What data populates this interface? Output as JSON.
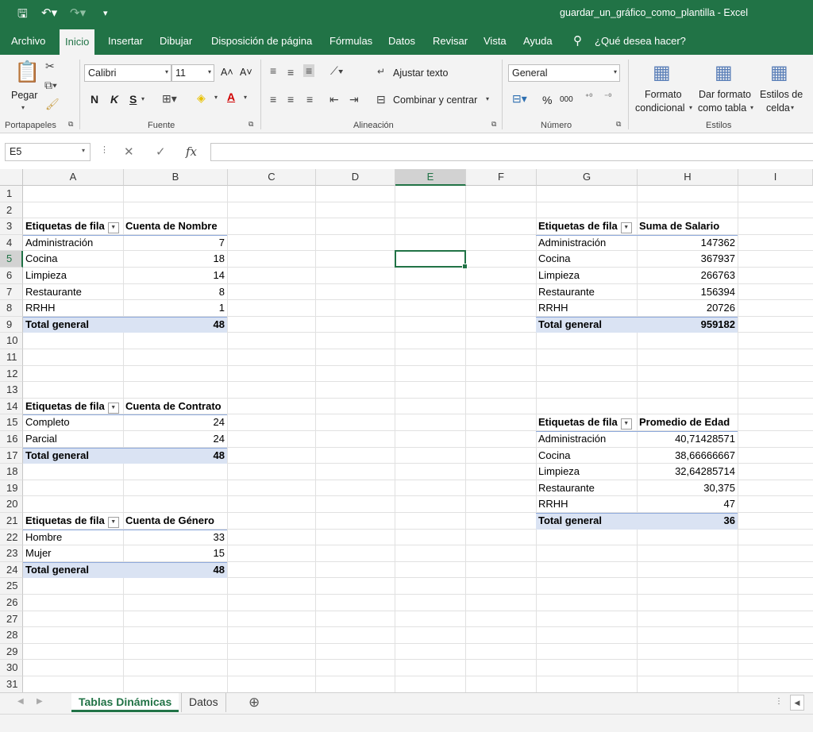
{
  "window": {
    "title": "guardar_un_gráfico_como_plantilla  -  Excel"
  },
  "tabs": [
    "Archivo",
    "Inicio",
    "Insertar",
    "Dibujar",
    "Disposición de página",
    "Fórmulas",
    "Datos",
    "Revisar",
    "Vista",
    "Ayuda"
  ],
  "tell_me": "¿Qué desea hacer?",
  "ribbon": {
    "pegar": "Pegar",
    "font_name": "Calibri",
    "font_size": "11",
    "bold": "N",
    "italic": "K",
    "underline": "S",
    "wrap_text": "Ajustar texto",
    "merge_center": "Combinar y centrar",
    "number_format": "General",
    "percent": "%",
    "thousands": "000",
    "cond_format_1": "Formato",
    "cond_format_2": "condicional",
    "format_table_1": "Dar formato",
    "format_table_2": "como tabla",
    "cell_styles_1": "Estilos de",
    "cell_styles_2": "celda",
    "groups": {
      "portapapeles": "Portapapeles",
      "fuente": "Fuente",
      "alineacion": "Alineación",
      "numero": "Número",
      "estilos": "Estilos"
    }
  },
  "formula_bar": {
    "name_box": "E5",
    "fx": "fx",
    "content": ""
  },
  "columns": [
    "A",
    "B",
    "C",
    "D",
    "E",
    "F",
    "G",
    "H",
    "I"
  ],
  "rows": [
    "1",
    "2",
    "3",
    "4",
    "5",
    "6",
    "7",
    "8",
    "9",
    "10",
    "11",
    "12",
    "13",
    "14",
    "15",
    "16",
    "17",
    "18",
    "19",
    "20",
    "21",
    "22",
    "23",
    "24",
    "25",
    "26",
    "27",
    "28",
    "29",
    "30",
    "31"
  ],
  "pivots": {
    "nombre": {
      "row_label": "Etiquetas de fila",
      "value_label": "Cuenta de Nombre",
      "rows": [
        {
          "label": "Administración",
          "value": "7"
        },
        {
          "label": "Cocina",
          "value": "18"
        },
        {
          "label": "Limpieza",
          "value": "14"
        },
        {
          "label": "Restaurante",
          "value": "8"
        },
        {
          "label": "RRHH",
          "value": "1"
        }
      ],
      "total_label": "Total general",
      "total": "48"
    },
    "contrato": {
      "row_label": "Etiquetas de fila",
      "value_label": "Cuenta de Contrato",
      "rows": [
        {
          "label": "Completo",
          "value": "24"
        },
        {
          "label": "Parcial",
          "value": "24"
        }
      ],
      "total_label": "Total general",
      "total": "48"
    },
    "genero": {
      "row_label": "Etiquetas de fila",
      "value_label": "Cuenta de Género",
      "rows": [
        {
          "label": "Hombre",
          "value": "33"
        },
        {
          "label": "Mujer",
          "value": "15"
        }
      ],
      "total_label": "Total general",
      "total": "48"
    },
    "salario": {
      "row_label": "Etiquetas de fila",
      "value_label": "Suma de Salario",
      "rows": [
        {
          "label": "Administración",
          "value": "147362"
        },
        {
          "label": "Cocina",
          "value": "367937"
        },
        {
          "label": "Limpieza",
          "value": "266763"
        },
        {
          "label": "Restaurante",
          "value": "156394"
        },
        {
          "label": "RRHH",
          "value": "20726"
        }
      ],
      "total_label": "Total general",
      "total": "959182"
    },
    "edad": {
      "row_label": "Etiquetas de fila",
      "value_label": "Promedio de Edad",
      "rows": [
        {
          "label": "Administración",
          "value": "40,71428571"
        },
        {
          "label": "Cocina",
          "value": "38,66666667"
        },
        {
          "label": "Limpieza",
          "value": "32,64285714"
        },
        {
          "label": "Restaurante",
          "value": "30,375"
        },
        {
          "label": "RRHH",
          "value": "47"
        }
      ],
      "total_label": "Total general",
      "total": "36"
    }
  },
  "sheets": [
    "Tablas Dinámicas",
    "Datos"
  ],
  "add_sheet": "⊕"
}
